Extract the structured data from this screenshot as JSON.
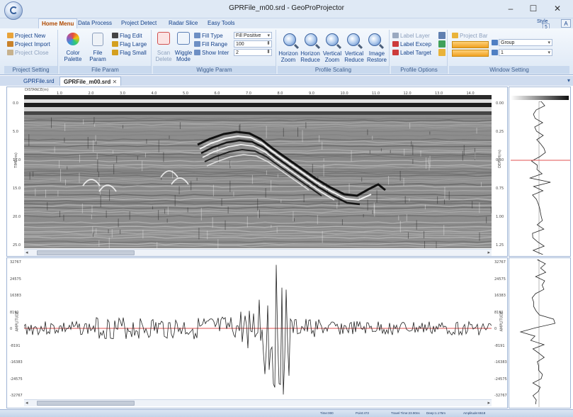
{
  "window": {
    "title": "GPRFile_m00.srd - GeoProProjector",
    "minimize_glyph": "–",
    "maximize_glyph": "☐",
    "close_glyph": "✕"
  },
  "ribbon_tabs": [
    "Home Menu",
    "Data Process",
    "Project Detect",
    "Radar Slice",
    "Easy Tools"
  ],
  "ribbon_right": {
    "style_label": "Style",
    "help_label": "A",
    "help_label2": "5"
  },
  "groups": {
    "project_setting": {
      "title": "Project Setting",
      "items": [
        "Project New",
        "Project Import",
        "Project Close"
      ]
    },
    "file_param": {
      "title": "File Param",
      "color_palette": "Color Palette",
      "file_param": "File Param",
      "items": [
        "Flag Edit",
        "Flag Large",
        "Flag Small"
      ]
    },
    "wiggle_param": {
      "title": "Wiggle Param",
      "scan_delete": "Scan Delete",
      "wiggle_mode": "Wiggle Mode",
      "fill_type_label": "Fill Type",
      "fill_type_value": "Fill Positive",
      "fill_range_label": "Fill Range",
      "fill_range_value": "100",
      "show_inter_label": "Show Inter",
      "show_inter_value": "2"
    },
    "profile_scaling": {
      "title": "Profile Scaling",
      "buttons": [
        "Horizon Zoom",
        "Horizon Reduce",
        "Vertical Zoom",
        "Vertical Reduce",
        "Image Restore"
      ]
    },
    "profile_options": {
      "title": "Profile Options",
      "items": [
        "Label Layer",
        "Label Excep",
        "Label Target"
      ]
    },
    "window_setting": {
      "title": "Window Setting",
      "project_bar": "Project Bar",
      "group_value": "Group",
      "second_value": "1"
    }
  },
  "doc_tabs": [
    "GPRFile.srd",
    "GPRFile_m00.srd"
  ],
  "doc_tab_close": "✕",
  "radargram": {
    "title_label": "DISTANCE(m)",
    "x_ticks": [
      "1.0",
      "2.0",
      "3.0",
      "4.0",
      "5.0",
      "6.0",
      "7.0",
      "8.0",
      "9.0",
      "10.0",
      "11.0",
      "12.0",
      "13.0",
      "14.0"
    ],
    "y_label": "TIME(ns)",
    "y_ticks": [
      "0.0",
      "5.0",
      "10.0",
      "15.0",
      "20.0",
      "25.0"
    ],
    "right_label": "DEPTH(m)",
    "right_ticks": [
      "0.00",
      "0.25",
      "0.50",
      "0.75",
      "1.00",
      "1.25"
    ]
  },
  "waveform": {
    "y_label": "AMPLITUDE",
    "left_ticks": [
      "32767",
      "24575",
      "16383",
      "8191",
      "0",
      "-8191",
      "-16383",
      "-24575",
      "-32767"
    ],
    "right_label": "AMPLITUDE",
    "right_ticks": [
      "32767",
      "24575",
      "16383",
      "8191",
      "0",
      "-8191",
      "-16383",
      "-24575",
      "-32767"
    ]
  },
  "status": [
    "Time:000",
    "Point:472",
    "Travel Time:23.90ns",
    "Deep:1.175m",
    "Amplitude:6518"
  ],
  "colors": {
    "accent": "#15428b",
    "ribbon_bg": "#dfe9f5",
    "zero_line": "#e05050"
  }
}
